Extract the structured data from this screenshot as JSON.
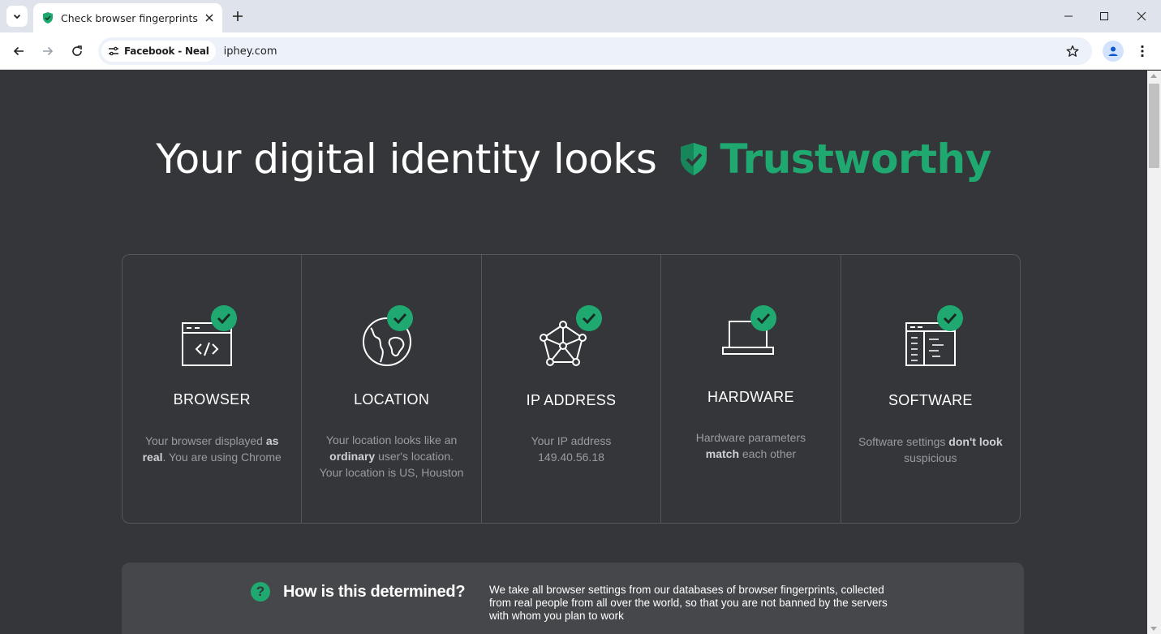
{
  "browser": {
    "tab_title": "Check browser fingerprints",
    "site_chip": "Facebook - Neal",
    "url": "iphey.com"
  },
  "headline": {
    "prefix": "Your digital identity looks",
    "status": "Trustworthy",
    "status_color": "#1fa971"
  },
  "cards": [
    {
      "title": "BROWSER",
      "icon": "browser-code-icon",
      "desc_parts": [
        "Your browser displayed ",
        "as real",
        ". You are using Chrome"
      ]
    },
    {
      "title": "LOCATION",
      "icon": "globe-icon",
      "desc_parts": [
        "Your location looks like an ",
        "ordinary",
        " user's location. Your location is US, Houston"
      ]
    },
    {
      "title": "IP ADDRESS",
      "icon": "network-icon",
      "desc": "Your IP address 149.40.56.18"
    },
    {
      "title": "HARDWARE",
      "icon": "laptop-icon",
      "desc_parts": [
        "Hardware parameters ",
        "match",
        " each other"
      ]
    },
    {
      "title": "SOFTWARE",
      "icon": "software-window-icon",
      "desc_parts": [
        "Software settings ",
        "don't look",
        " suspicious"
      ]
    }
  ],
  "info": {
    "title": "How is this determined?",
    "text": "We take all browser settings from our databases of browser fingerprints, collected from real people from all over the world, so that you are not banned by the servers with whom you plan to work"
  }
}
